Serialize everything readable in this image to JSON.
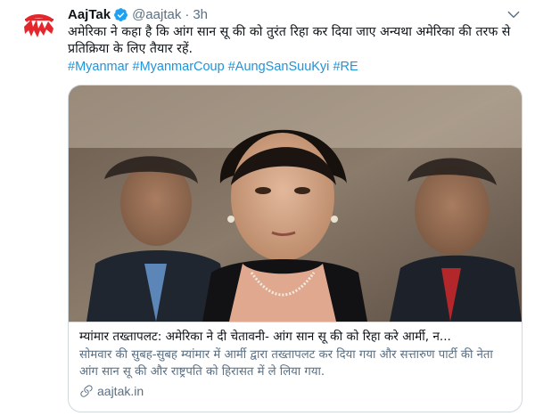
{
  "tweet": {
    "display_name": "AajTak",
    "handle": "@aajtak",
    "separator": "·",
    "time": "3h",
    "text": "अमेरिका ने कहा है कि आंग सान सू की को तुरंत रिहा कर दिया जाए अन्यथा अमेरिका की तरफ से प्रतिक्रिया के लिए तैयार रहें.",
    "hashtags": [
      "#Myanmar",
      "#MyanmarCoup",
      "#AungSanSuuKyi",
      "#RE"
    ],
    "avatar_logo_text": "आज तक"
  },
  "card": {
    "title": "म्यांमार तख्तापलट: अमेरिका ने दी चेतावनी- आंग सान सू की को रिहा करे आर्मी, न...",
    "description": "सोमवार की सुबह-सुबह म्यांमार में आर्मी द्वारा तख्तापलट कर दिया गया और सत्तारुण पार्टी की नेता आंग सान सू की और राष्ट्रपति को हिरासत में ले लिया गया.",
    "domain": "aajtak.in"
  },
  "icons": {
    "verified": "verified-badge-icon",
    "more": "chevron-down-icon",
    "link": "link-icon"
  },
  "colors": {
    "link_blue": "#1b95e0",
    "secondary_text": "#5b7083",
    "card_border": "#cfd9de",
    "brand_red": "#e4262d"
  }
}
